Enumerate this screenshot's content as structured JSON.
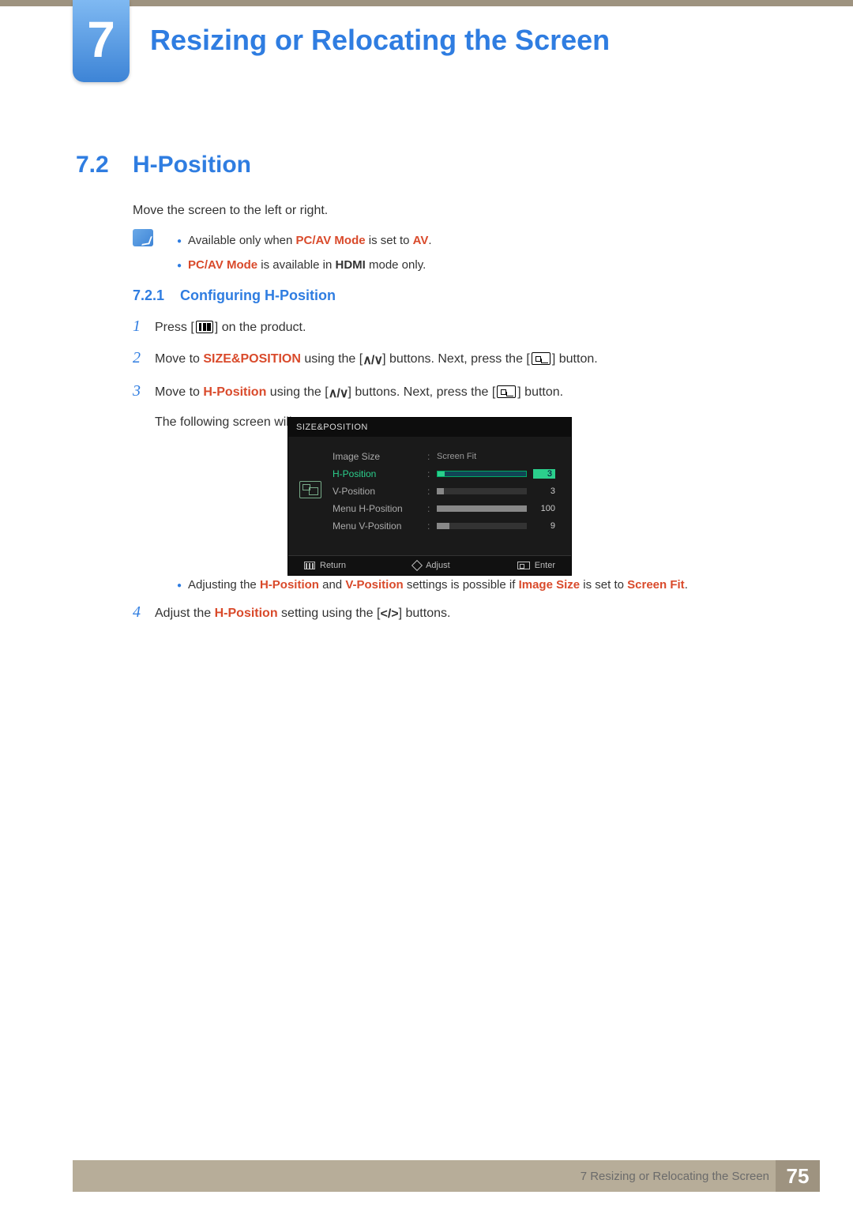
{
  "chapter": {
    "number": "7",
    "title": "Resizing or Relocating the Screen"
  },
  "section": {
    "number": "7.2",
    "title": "H-Position"
  },
  "intro": "Move the screen to the left or right.",
  "notes": {
    "line1_pre": "Available only when ",
    "line1_b1": "PC/AV Mode",
    "line1_mid": " is set to ",
    "line1_b2": "AV",
    "line1_post": ".",
    "line2_b1": "PC/AV Mode",
    "line2_mid": " is available in ",
    "line2_b2": "HDMI",
    "line2_post": " mode only."
  },
  "subsection": {
    "number": "7.2.1",
    "title": "Configuring H-Position"
  },
  "steps": {
    "s1_a": "Press [",
    "s1_b": "] on the product.",
    "s2_a": "Move to ",
    "s2_size": "SIZE&POSITION",
    "s2_b": " using the [",
    "s2_c": "] buttons. Next, press the [",
    "s2_d": "] button.",
    "s3_a": "Move to ",
    "s3_hpos": "H-Position",
    "s3_b": " using the [",
    "s3_c": "] buttons. Next, press the [",
    "s3_d": "] button.",
    "s3_e": "The following screen will appear.",
    "s4_a": "Adjust the ",
    "s4_hpos": "H-Position",
    "s4_b": " setting using the [",
    "s4_c": "] buttons."
  },
  "osd": {
    "title": "SIZE&POSITION",
    "rows": [
      {
        "label": "Image Size",
        "value_text": "Screen Fit"
      },
      {
        "label": "H-Position",
        "value_num": "3",
        "fill": 8,
        "active": true
      },
      {
        "label": "V-Position",
        "value_num": "3",
        "fill": 8
      },
      {
        "label": "Menu H-Position",
        "value_num": "100",
        "fill": 100
      },
      {
        "label": "Menu V-Position",
        "value_num": "9",
        "fill": 14
      }
    ],
    "footer": {
      "return": "Return",
      "adjust": "Adjust",
      "enter": "Enter"
    }
  },
  "sub_bullet": {
    "a": "Adjusting the ",
    "hpos": "H-Position",
    "b": " and ",
    "vpos": "V-Position",
    "c": " settings is possible if ",
    "imgsize": "Image Size",
    "d": " is set to ",
    "screenfit": "Screen Fit",
    "e": "."
  },
  "footer": {
    "text": "7 Resizing or Relocating the Screen",
    "page": "75"
  }
}
